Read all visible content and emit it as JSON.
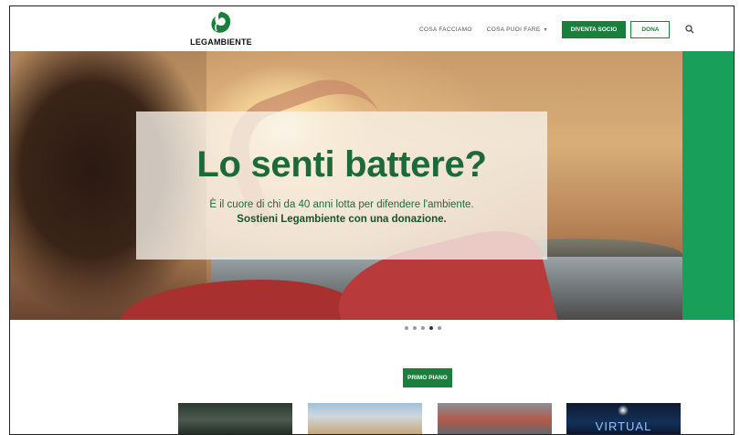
{
  "brand": {
    "name": "LEGAMBIENTE",
    "color": "#1a7f3c"
  },
  "nav": {
    "items": [
      {
        "label": "COSA FACCIAMO"
      },
      {
        "label": "COSA PUOI FARE",
        "has_dropdown": true
      }
    ],
    "cta_primary": "DIVENTA SOCIO",
    "cta_secondary": "DONA",
    "search_icon": "search-icon"
  },
  "hero": {
    "headline": "Lo senti battere?",
    "subtitle_line1": "È il cuore di chi da 40 anni lotta per difendere l'ambiente.",
    "subtitle_line2": "Sostieni Legambiente con una donazione.",
    "accent_color": "#18a05a",
    "headline_color": "#1d6a38"
  },
  "carousel": {
    "slide_count": 5,
    "active_index": 3
  },
  "section": {
    "label": "PRIMO PIANO"
  },
  "thumbnails": [
    {
      "alt": ""
    },
    {
      "alt": ""
    },
    {
      "alt": ""
    },
    {
      "caption": "VIRTUAL"
    }
  ]
}
